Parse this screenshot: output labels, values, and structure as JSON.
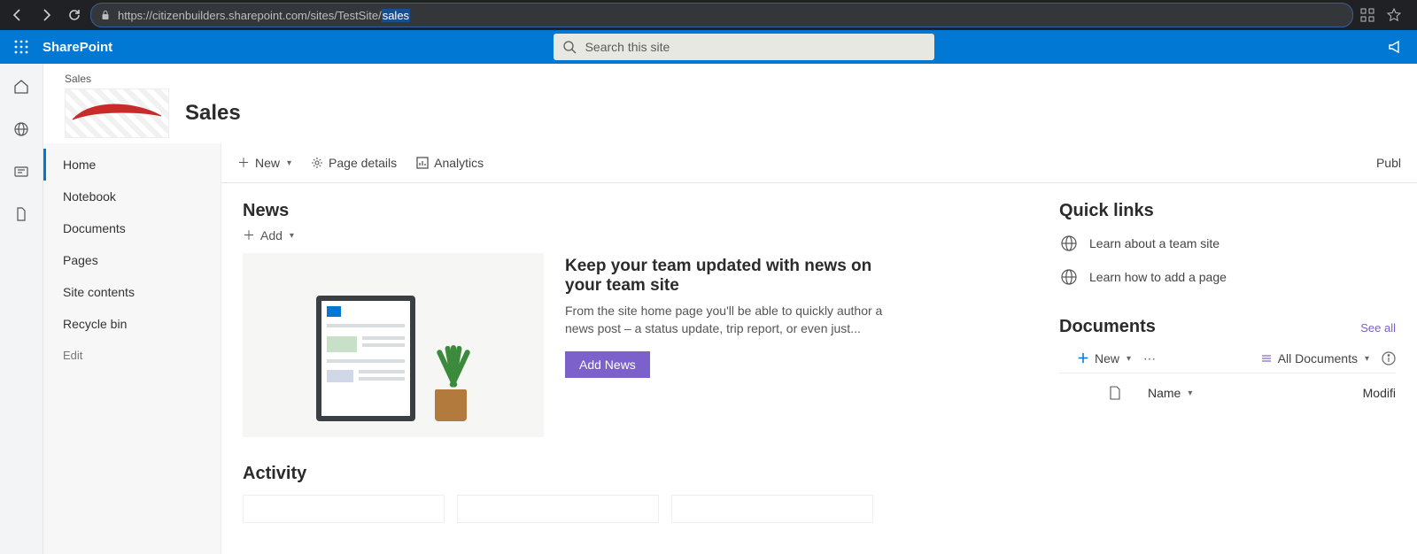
{
  "browser": {
    "url_prefix": "https://citizenbuilders.sharepoint.com/sites/TestSite/",
    "url_selected": "sales"
  },
  "suite": {
    "app": "SharePoint",
    "search_placeholder": "Search this site"
  },
  "site": {
    "breadcrumb": "Sales",
    "title": "Sales"
  },
  "nav": {
    "items": [
      "Home",
      "Notebook",
      "Documents",
      "Pages",
      "Site contents",
      "Recycle bin"
    ],
    "edit": "Edit"
  },
  "commands": {
    "new": "New",
    "page_details": "Page details",
    "analytics": "Analytics",
    "publish": "Publ"
  },
  "news": {
    "heading": "News",
    "add": "Add",
    "title": "Keep your team updated with news on your team site",
    "body": "From the site home page you'll be able to quickly author a news post – a status update, trip report, or even just...",
    "cta": "Add News"
  },
  "activity": {
    "heading": "Activity"
  },
  "quicklinks": {
    "heading": "Quick links",
    "items": [
      "Learn about a team site",
      "Learn how to add a page"
    ]
  },
  "documents": {
    "heading": "Documents",
    "see_all": "See all",
    "new": "New",
    "view": "All Documents",
    "col_name": "Name",
    "col_modified": "Modifi"
  }
}
